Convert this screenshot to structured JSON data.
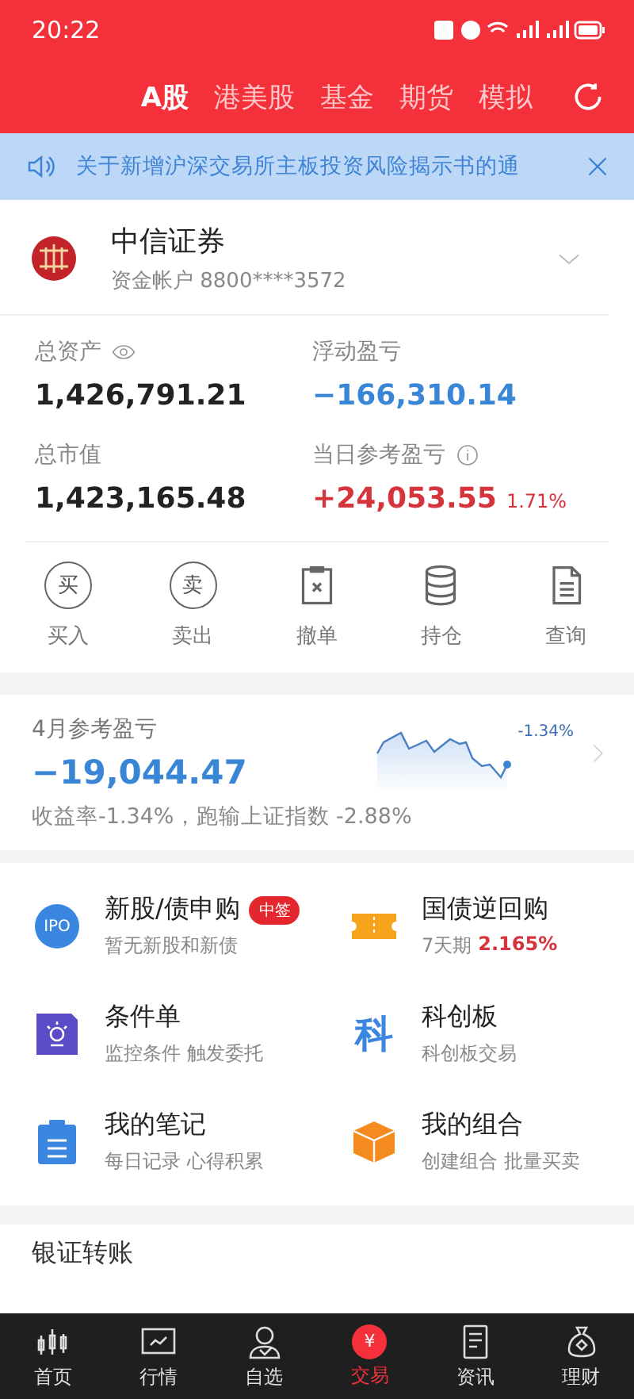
{
  "status_bar": {
    "time": "20:22"
  },
  "market_tabs": [
    {
      "label": "A股",
      "selected": true
    },
    {
      "label": "港美股",
      "selected": false
    },
    {
      "label": "基金",
      "selected": false
    },
    {
      "label": "期货",
      "selected": false
    },
    {
      "label": "模拟",
      "selected": false
    }
  ],
  "notice": {
    "text": "关于新增沪深交易所主板投资风险揭示书的通"
  },
  "account": {
    "broker": "中信证券",
    "account_label": "资金帐户 8800****3572",
    "stats": [
      {
        "kind": "hideable",
        "label": "总资产",
        "value": "1,426,791.21",
        "color": "#222222"
      },
      {
        "kind": "plain",
        "label": "浮动盈亏",
        "value": "−166,310.14",
        "color": "#3a86d6"
      },
      {
        "kind": "plain",
        "label": "总市值",
        "value": "1,423,165.48",
        "color": "#222222"
      },
      {
        "kind": "explained",
        "label": "当日参考盈亏",
        "value": "+24,053.55",
        "color": "#d6343c",
        "percent": "1.71%"
      }
    ],
    "actions": [
      {
        "label": "买入",
        "kind": "buy",
        "glyph": "买"
      },
      {
        "label": "卖出",
        "kind": "sell",
        "glyph": "卖"
      },
      {
        "label": "撤单",
        "kind": "cancel"
      },
      {
        "label": "持仓",
        "kind": "holdings"
      },
      {
        "label": "查询",
        "kind": "query"
      }
    ]
  },
  "monthly": {
    "label": "4月参考盈亏",
    "value": "−19,044.47",
    "chart_label": "-1.34%",
    "summary": "收益率-1.34%，跑输上证指数 -2.88%"
  },
  "services": [
    {
      "kind": "ipo",
      "icon_text": "IPO",
      "title": "新股/债申购",
      "badge": "中签",
      "subtitle": "暂无新股和新债"
    },
    {
      "kind": "repo",
      "title": "国债逆回购",
      "subtitle": "7天期",
      "highlight": "2.165%"
    },
    {
      "kind": "condition",
      "title": "条件单",
      "subtitle": "监控条件 触发委托"
    },
    {
      "kind": "star",
      "icon_text": "科",
      "title": "科创板",
      "subtitle": "科创板交易"
    },
    {
      "kind": "notes",
      "title": "我的笔记",
      "subtitle": "每日记录 心得积累"
    },
    {
      "kind": "portfolio",
      "title": "我的组合",
      "subtitle": "创建组合 批量买卖"
    }
  ],
  "transfer": {
    "label": "银证转账"
  },
  "bottom_nav": [
    {
      "label": "首页",
      "kind": "home",
      "selected": false
    },
    {
      "label": "行情",
      "kind": "market",
      "selected": false
    },
    {
      "label": "自选",
      "kind": "watch",
      "selected": false
    },
    {
      "label": "交易",
      "kind": "trade",
      "glyph": "¥",
      "selected": true
    },
    {
      "label": "资讯",
      "kind": "news",
      "selected": false
    },
    {
      "label": "理财",
      "kind": "wealth",
      "selected": false
    }
  ]
}
